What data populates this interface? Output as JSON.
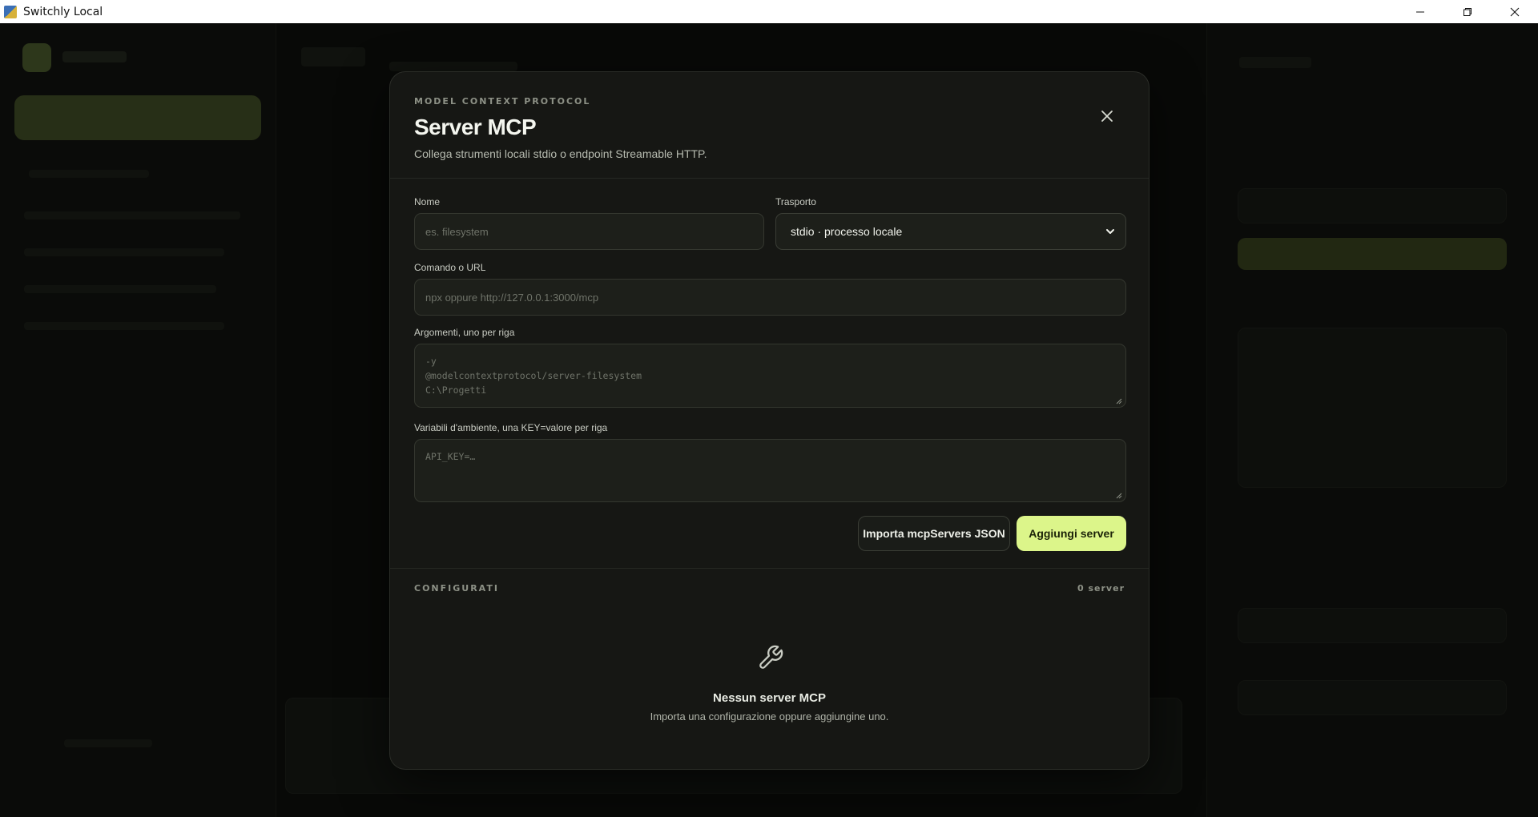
{
  "window": {
    "title": "Switchly Local",
    "controls": {
      "minimize": "—",
      "restore": "❐",
      "close": "✕"
    }
  },
  "modal": {
    "eyebrow": "MODEL CONTEXT PROTOCOL",
    "title": "Server MCP",
    "subtitle": "Collega strumenti locali stdio o endpoint Streamable HTTP.",
    "form": {
      "name_label": "Nome",
      "name_placeholder": "es. filesystem",
      "transport_label": "Trasporto",
      "transport_value": "stdio · processo locale",
      "command_label": "Comando o URL",
      "command_placeholder": "npx oppure http://127.0.0.1:3000/mcp",
      "args_label": "Argomenti, uno per riga",
      "args_placeholder": "-y\n@modelcontextprotocol/server-filesystem\nC:\\Progetti",
      "env_label": "Variabili d'ambiente, una KEY=valore per riga",
      "env_placeholder": "API_KEY=…"
    },
    "actions": {
      "import_label": "Importa mcpServers JSON",
      "add_label": "Aggiungi server"
    },
    "configured": {
      "title": "CONFIGURATI",
      "count": "0 server",
      "empty_title": "Nessun server MCP",
      "empty_text": "Importa una configurazione oppure aggiungine uno."
    }
  },
  "colors": {
    "accent": "#dcf58a",
    "modal_bg": "#161714",
    "backdrop": "#0a0b09"
  },
  "icons": {
    "close": "close-icon",
    "chevron": "chevron-down-icon",
    "empty": "wrench-icon"
  }
}
